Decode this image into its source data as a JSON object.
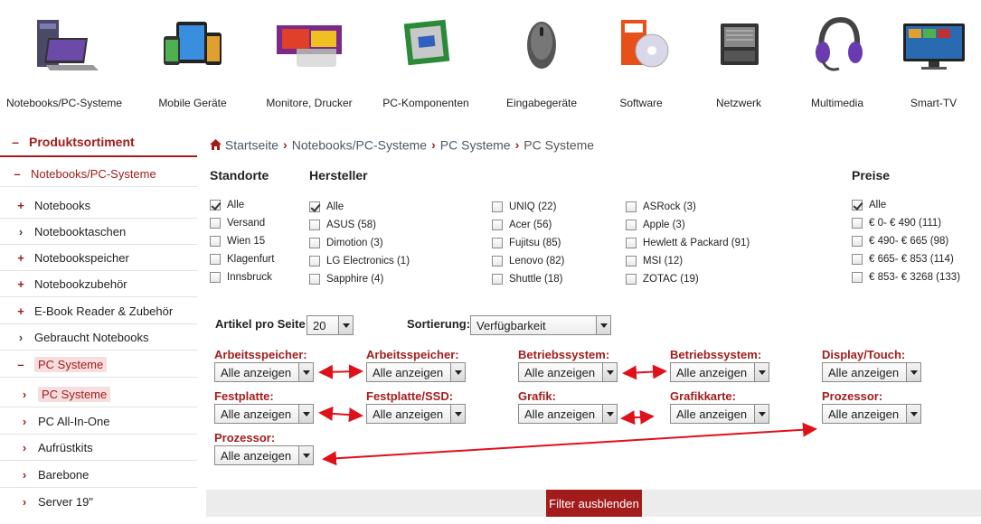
{
  "categories": [
    {
      "label": "Notebooks/PC-Systeme",
      "icon": "desktop-notebook-icon"
    },
    {
      "label": "Mobile Geräte",
      "icon": "tablet-phone-icon"
    },
    {
      "label": "Monitore, Drucker",
      "icon": "printer-icon"
    },
    {
      "label": "PC-Komponenten",
      "icon": "cpu-icon"
    },
    {
      "label": "Eingabegeräte",
      "icon": "mouse-icon"
    },
    {
      "label": "Software",
      "icon": "software-box-icon"
    },
    {
      "label": "Netzwerk",
      "icon": "server-icon"
    },
    {
      "label": "Multimedia",
      "icon": "headset-icon"
    },
    {
      "label": "Smart-TV",
      "icon": "tv-icon"
    }
  ],
  "sidebar": {
    "heading": "Produktsortiment",
    "items": [
      {
        "label": "Notebooks/PC-Systeme",
        "marker": "–"
      },
      {
        "label": "Notebooks",
        "marker": "+"
      },
      {
        "label": "Notebooktaschen",
        "marker": "›"
      },
      {
        "label": "Notebookspeicher",
        "marker": "+"
      },
      {
        "label": "Notebookzubehör",
        "marker": "+"
      },
      {
        "label": "E-Book Reader & Zubehör",
        "marker": "+"
      },
      {
        "label": "Gebraucht Notebooks",
        "marker": "›"
      },
      {
        "label": "PC Systeme",
        "marker": "–"
      },
      {
        "label": "PC Systeme",
        "marker": "›"
      },
      {
        "label": "PC All-In-One",
        "marker": "›"
      },
      {
        "label": "Aufrüstkits",
        "marker": "›"
      },
      {
        "label": "Barebone",
        "marker": "›"
      },
      {
        "label": "Server 19\"",
        "marker": "›"
      }
    ]
  },
  "breadcrumb": {
    "home": "Startseite",
    "items": [
      "Notebooks/PC-Systeme",
      "PC Systeme"
    ],
    "current": "PC Systeme"
  },
  "filters": {
    "standorte": {
      "title": "Standorte",
      "options": [
        {
          "label": "Alle",
          "checked": true
        },
        {
          "label": "Versand",
          "checked": false
        },
        {
          "label": "Wien 15",
          "checked": false
        },
        {
          "label": "Klagenfurt",
          "checked": false
        },
        {
          "label": "Innsbruck",
          "checked": false
        }
      ]
    },
    "hersteller": {
      "title": "Hersteller",
      "col1": [
        {
          "label": "Alle",
          "checked": true
        },
        {
          "label": "ASUS (58)",
          "checked": false
        },
        {
          "label": "Dimotion (3)",
          "checked": false
        },
        {
          "label": "LG Electronics (1)",
          "checked": false
        },
        {
          "label": "Sapphire (4)",
          "checked": false
        }
      ],
      "col2": [
        {
          "label": "UNIQ (22)",
          "checked": false
        },
        {
          "label": "Acer (56)",
          "checked": false
        },
        {
          "label": "Fujitsu (85)",
          "checked": false
        },
        {
          "label": "Lenovo (82)",
          "checked": false
        },
        {
          "label": "Shuttle (18)",
          "checked": false
        }
      ],
      "col3": [
        {
          "label": "ASRock (3)",
          "checked": false
        },
        {
          "label": "Apple (3)",
          "checked": false
        },
        {
          "label": "Hewlett & Packard (91)",
          "checked": false
        },
        {
          "label": "MSI (12)",
          "checked": false
        },
        {
          "label": "ZOTAC (19)",
          "checked": false
        }
      ]
    },
    "preise": {
      "title": "Preise",
      "options": [
        {
          "label": "Alle",
          "checked": true
        },
        {
          "label": "€ 0- € 490 (111)",
          "checked": false
        },
        {
          "label": "€ 490- € 665 (98)",
          "checked": false
        },
        {
          "label": "€ 665- € 853 (114)",
          "checked": false
        },
        {
          "label": "€ 853- € 3268 (133)",
          "checked": false
        }
      ]
    }
  },
  "controls": {
    "per_page_label": "Artikel pro Seite:",
    "per_page_value": "20",
    "sort_label": "Sortierung:",
    "sort_value": "Verfügbarkeit"
  },
  "attr_filters": [
    {
      "label": "Arbeitsspeicher:",
      "value": "Alle anzeigen"
    },
    {
      "label": "Arbeitsspeicher:",
      "value": "Alle anzeigen"
    },
    {
      "label": "Betriebssystem:",
      "value": "Alle anzeigen"
    },
    {
      "label": "Betriebssystem:",
      "value": "Alle anzeigen"
    },
    {
      "label": "Display/Touch:",
      "value": "Alle anzeigen"
    },
    {
      "label": "Festplatte:",
      "value": "Alle anzeigen"
    },
    {
      "label": "Festplatte/SSD:",
      "value": "Alle anzeigen"
    },
    {
      "label": "Grafik:",
      "value": "Alle anzeigen"
    },
    {
      "label": "Grafikkarte:",
      "value": "Alle anzeigen"
    },
    {
      "label": "Prozessor:",
      "value": "Alle anzeigen"
    },
    {
      "label": "Prozessor:",
      "value": "Alle anzeigen"
    }
  ],
  "bottom": {
    "button_label": "Filter ausblenden"
  },
  "colors": {
    "accent": "#a31c1c",
    "arrow": "#e0101a"
  }
}
